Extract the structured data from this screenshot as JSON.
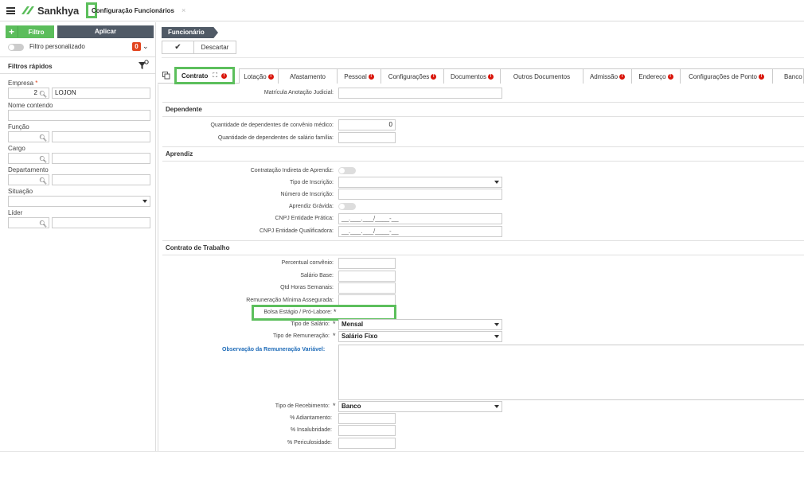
{
  "app": {
    "brand": "Sankhya",
    "tab_title": "Configuração Funcionários",
    "tab_close": "×"
  },
  "left": {
    "filter_btn": "Filtro",
    "apply_btn": "Aplicar",
    "custom_filter_label": "Filtro personalizado",
    "custom_filter_count": "0",
    "quick_filters_title": "Filtros rápidos",
    "fields": {
      "empresa_label": "Empresa",
      "empresa_code": "2",
      "empresa_name": "LOJON",
      "nome_label": "Nome contendo",
      "funcao_label": "Função",
      "cargo_label": "Cargo",
      "departamento_label": "Departamento",
      "situacao_label": "Situação",
      "lider_label": "Líder"
    }
  },
  "header": {
    "breadcrumb": "Funcionário",
    "confirm_icon": "✔",
    "discard": "Descartar"
  },
  "tabs": [
    {
      "label": "Contrato",
      "error": true,
      "active": true
    },
    {
      "label": "Lotação",
      "error": true
    },
    {
      "label": "Afastamento",
      "error": false
    },
    {
      "label": "Pessoal",
      "error": true
    },
    {
      "label": "Configurações",
      "error": true
    },
    {
      "label": "Documentos",
      "error": true
    },
    {
      "label": "Outros Documentos",
      "error": false
    },
    {
      "label": "Admissão",
      "error": true
    },
    {
      "label": "Endereço",
      "error": true
    },
    {
      "label": "Configurações de Ponto",
      "error": true
    },
    {
      "label": "Banco",
      "error": false
    }
  ],
  "form": {
    "matricula_label": "Matrícula Anotação Judicial:",
    "sect_dependente": "Dependente",
    "dep_convenio_label": "Quantidade de dependentes de convênio médico:",
    "dep_convenio_value": "0",
    "dep_salario_label": "Quantidade de dependentes de salário família:",
    "sect_aprendiz": "Aprendiz",
    "contratacao_label": "Contratação Indireta de Aprendiz:",
    "tipo_inscricao_label": "Tipo de Inscrição:",
    "numero_inscricao_label": "Número de Inscrição:",
    "aprendiz_gravida_label": "Aprendiz Grávida:",
    "cnpj_pratica_label": "CNPJ Entidade Prática:",
    "cnpj_pratica_mask": "__.___.___/____-__",
    "cnpj_qualif_label": "CNPJ Entidade Qualificadora:",
    "cnpj_qualif_mask": "__.___.___/____-__",
    "sect_contrato": "Contrato de Trabalho",
    "percentual_label": "Percentual convênio:",
    "salario_base_label": "Salário Base:",
    "qtd_horas_label": "Qtd Horas Semanais:",
    "remun_min_label": "Remuneração Mínima Assegurada:",
    "bolsa_label": "Bolsa Estágio / Pró-Labore:",
    "tipo_salario_label": "Tipo de Salário:",
    "tipo_salario_value": "Mensal",
    "tipo_remun_label": "Tipo de Remuneração:",
    "tipo_remun_value": "Salário Fixo",
    "obs_label": "Observação da Remuneração Variável:",
    "tipo_receb_label": "Tipo de Recebimento:",
    "tipo_receb_value": "Banco",
    "adiantamento_label": "% Adiantamento:",
    "insalubridade_label": "% Insalubridade:",
    "periculosidade_label": "% Periculosidade:",
    "required_mark": "*"
  },
  "colors": {
    "accent_green": "#5cbf5c",
    "dark_slate": "#505a66",
    "error_red": "#d9150a",
    "link_blue": "#1e6bb8"
  }
}
